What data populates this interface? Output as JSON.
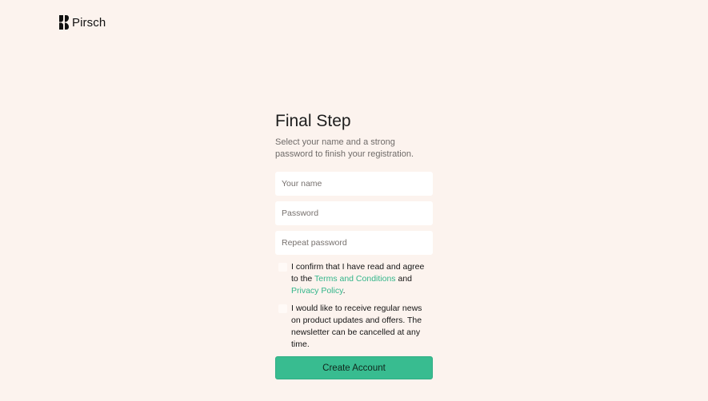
{
  "brand": {
    "name": "Pirsch",
    "logo_icon": "pirsch-logo-icon"
  },
  "form": {
    "title": "Final Step",
    "subtitle": "Select your name and a strong password to finish your registration.",
    "name_placeholder": "Your name",
    "password_placeholder": "Password",
    "repeat_password_placeholder": "Repeat password",
    "terms": {
      "prefix": "I confirm that I have read and agree to the ",
      "terms_link": "Terms and Conditions",
      "middle": " and ",
      "privacy_link": "Privacy Policy",
      "suffix": "."
    },
    "newsletter_text": "I would like to receive regular news on product updates and offers. The newsletter can be cancelled at any time.",
    "submit_label": "Create Account"
  },
  "colors": {
    "background": "#fcf3ee",
    "accent": "#38bc90",
    "link": "#33b58a"
  }
}
